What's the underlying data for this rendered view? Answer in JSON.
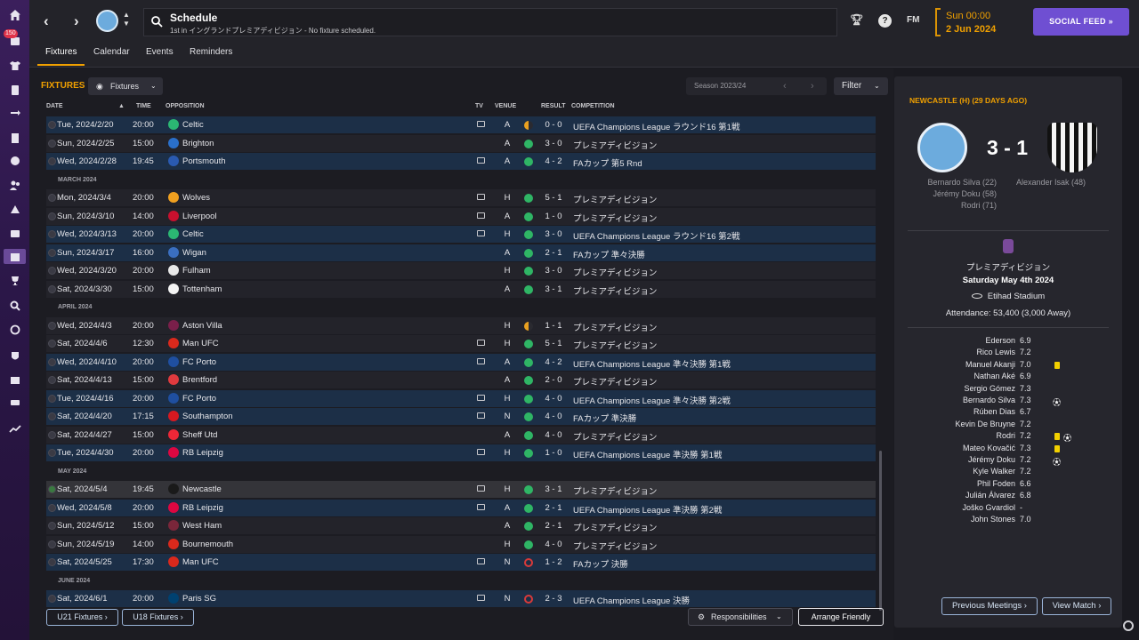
{
  "sidebar": {
    "badge": "150"
  },
  "header": {
    "title": "Schedule",
    "subtitle": "1st in イングランドプレミアディビジョン - No fixture scheduled.",
    "fm_label": "FM",
    "help": "?",
    "date_line1": "Sun 00:00",
    "date_line2": "2 Jun 2024",
    "social_feed": "SOCIAL FEED »"
  },
  "tabs": [
    "Fixtures",
    "Calendar",
    "Events",
    "Reminders"
  ],
  "fixtures": {
    "title": "FIXTURES",
    "view_dropdown": "Fixtures",
    "season": "Season 2023/24",
    "filter": "Filter",
    "columns": {
      "date": "DATE",
      "time": "TIME",
      "opposition": "OPPOSITION",
      "tv": "TV",
      "venue": "VENUE",
      "result": "RESULT",
      "competition": "COMPETITION"
    },
    "rows": [
      {
        "type": "m",
        "date": "Tue, 2024/2/20",
        "time": "20:00",
        "opp": "Celtic",
        "crest": "#2bb673",
        "tv": true,
        "venue": "A",
        "res": "draw",
        "score": "0 - 0",
        "comp": "UEFA Champions League ラウンド16 第1戦",
        "bg": "c1"
      },
      {
        "type": "m",
        "date": "Sun, 2024/2/25",
        "time": "15:00",
        "opp": "Brighton",
        "crest": "#2a6fc9",
        "tv": false,
        "venue": "A",
        "res": "win",
        "score": "3 - 0",
        "comp": "プレミアディビジョン",
        "bg": "c0"
      },
      {
        "type": "m",
        "date": "Wed, 2024/2/28",
        "time": "19:45",
        "opp": "Portsmouth",
        "crest": "#2a5ab0",
        "tv": true,
        "venue": "A",
        "res": "win",
        "score": "4 - 2",
        "comp": "FAカップ 第5 Rnd",
        "bg": "c1"
      },
      {
        "type": "s",
        "label": "MARCH 2024"
      },
      {
        "type": "m",
        "date": "Mon, 2024/3/4",
        "time": "20:00",
        "opp": "Wolves",
        "crest": "#f0a020",
        "tv": true,
        "venue": "H",
        "res": "win",
        "score": "5 - 1",
        "comp": "プレミアディビジョン",
        "bg": "c0"
      },
      {
        "type": "m",
        "date": "Sun, 2024/3/10",
        "time": "14:00",
        "opp": "Liverpool",
        "crest": "#c8102e",
        "tv": true,
        "venue": "A",
        "res": "win",
        "score": "1 - 0",
        "comp": "プレミアディビジョン",
        "bg": "c0"
      },
      {
        "type": "m",
        "date": "Wed, 2024/3/13",
        "time": "20:00",
        "opp": "Celtic",
        "crest": "#2bb673",
        "tv": true,
        "venue": "H",
        "res": "win",
        "score": "3 - 0",
        "comp": "UEFA Champions League ラウンド16 第2戦",
        "bg": "c1"
      },
      {
        "type": "m",
        "date": "Sun, 2024/3/17",
        "time": "16:00",
        "opp": "Wigan",
        "crest": "#3a6fc0",
        "tv": false,
        "venue": "A",
        "res": "win",
        "score": "2 - 1",
        "comp": "FAカップ 準々決勝",
        "bg": "c1"
      },
      {
        "type": "m",
        "date": "Wed, 2024/3/20",
        "time": "20:00",
        "opp": "Fulham",
        "crest": "#e8e8e8",
        "tv": false,
        "venue": "H",
        "res": "win",
        "score": "3 - 0",
        "comp": "プレミアディビジョン",
        "bg": "c0"
      },
      {
        "type": "m",
        "date": "Sat, 2024/3/30",
        "time": "15:00",
        "opp": "Tottenham",
        "crest": "#f4f4f4",
        "tv": false,
        "venue": "A",
        "res": "win",
        "score": "3 - 1",
        "comp": "プレミアディビジョン",
        "bg": "c0"
      },
      {
        "type": "s",
        "label": "APRIL 2024"
      },
      {
        "type": "m",
        "date": "Wed, 2024/4/3",
        "time": "20:00",
        "opp": "Aston Villa",
        "crest": "#7a1f4a",
        "tv": false,
        "venue": "H",
        "res": "draw",
        "score": "1 - 1",
        "comp": "プレミアディビジョン",
        "bg": "c0"
      },
      {
        "type": "m",
        "date": "Sat, 2024/4/6",
        "time": "12:30",
        "opp": "Man UFC",
        "crest": "#da291c",
        "tv": true,
        "venue": "H",
        "res": "win",
        "score": "5 - 1",
        "comp": "プレミアディビジョン",
        "bg": "c0"
      },
      {
        "type": "m",
        "date": "Wed, 2024/4/10",
        "time": "20:00",
        "opp": "FC Porto",
        "crest": "#1f4fa0",
        "tv": true,
        "venue": "A",
        "res": "win",
        "score": "4 - 2",
        "comp": "UEFA Champions League 準々決勝 第1戦",
        "bg": "c1"
      },
      {
        "type": "m",
        "date": "Sat, 2024/4/13",
        "time": "15:00",
        "opp": "Brentford",
        "crest": "#e03a3e",
        "tv": false,
        "venue": "A",
        "res": "win",
        "score": "2 - 0",
        "comp": "プレミアディビジョン",
        "bg": "c0"
      },
      {
        "type": "m",
        "date": "Tue, 2024/4/16",
        "time": "20:00",
        "opp": "FC Porto",
        "crest": "#1f4fa0",
        "tv": true,
        "venue": "H",
        "res": "win",
        "score": "4 - 0",
        "comp": "UEFA Champions League 準々決勝 第2戦",
        "bg": "c1"
      },
      {
        "type": "m",
        "date": "Sat, 2024/4/20",
        "time": "17:15",
        "opp": "Southampton",
        "crest": "#d71920",
        "tv": true,
        "venue": "N",
        "res": "win",
        "score": "4 - 0",
        "comp": "FAカップ 準決勝",
        "bg": "c1"
      },
      {
        "type": "m",
        "date": "Sat, 2024/4/27",
        "time": "15:00",
        "opp": "Sheff Utd",
        "crest": "#ee2737",
        "tv": false,
        "venue": "A",
        "res": "win",
        "score": "4 - 0",
        "comp": "プレミアディビジョン",
        "bg": "c0"
      },
      {
        "type": "m",
        "date": "Tue, 2024/4/30",
        "time": "20:00",
        "opp": "RB Leipzig",
        "crest": "#dd0741",
        "tv": true,
        "venue": "H",
        "res": "win",
        "score": "1 - 0",
        "comp": "UEFA Champions League 準決勝 第1戦",
        "bg": "c1"
      },
      {
        "type": "s",
        "label": "MAY 2024"
      },
      {
        "type": "m",
        "date": "Sat, 2024/5/4",
        "time": "19:45",
        "opp": "Newcastle",
        "crest": "#1a1a1a",
        "tv": true,
        "venue": "H",
        "res": "win",
        "score": "3 - 1",
        "comp": "プレミアディビジョン",
        "bg": "hl",
        "done": true
      },
      {
        "type": "m",
        "date": "Wed, 2024/5/8",
        "time": "20:00",
        "opp": "RB Leipzig",
        "crest": "#dd0741",
        "tv": true,
        "venue": "A",
        "res": "win",
        "score": "2 - 1",
        "comp": "UEFA Champions League 準決勝 第2戦",
        "bg": "c1"
      },
      {
        "type": "m",
        "date": "Sun, 2024/5/12",
        "time": "15:00",
        "opp": "West Ham",
        "crest": "#7a263a",
        "tv": false,
        "venue": "A",
        "res": "win",
        "score": "2 - 1",
        "comp": "プレミアディビジョン",
        "bg": "c0"
      },
      {
        "type": "m",
        "date": "Sun, 2024/5/19",
        "time": "14:00",
        "opp": "Bournemouth",
        "crest": "#da291c",
        "tv": false,
        "venue": "H",
        "res": "win",
        "score": "4 - 0",
        "comp": "プレミアディビジョン",
        "bg": "c0"
      },
      {
        "type": "m",
        "date": "Sat, 2024/5/25",
        "time": "17:30",
        "opp": "Man UFC",
        "crest": "#da291c",
        "tv": true,
        "venue": "N",
        "res": "loss",
        "score": "1 - 2",
        "comp": "FAカップ 決勝",
        "bg": "c1"
      },
      {
        "type": "s",
        "label": "JUNE 2024"
      },
      {
        "type": "m",
        "date": "Sat, 2024/6/1",
        "time": "20:00",
        "opp": "Paris SG",
        "crest": "#004170",
        "tv": true,
        "venue": "N",
        "res": "loss",
        "score": "2 - 3",
        "comp": "UEFA Champions League 決勝",
        "bg": "c1"
      }
    ],
    "btn_u21": "U21 Fixtures ›",
    "btn_u18": "U18 Fixtures ›",
    "btn_responsibilities": "Responsibilities",
    "btn_arrange": "Arrange Friendly"
  },
  "match": {
    "heading": "NEWCASTLE (H) (29 DAYS AGO)",
    "score": "3 - 1",
    "home_scorers": [
      "Bernardo Silva (22)",
      "Jérémy Doku (58)",
      "Rodri (71)"
    ],
    "away_scorers": [
      "Alexander Isak (48)"
    ],
    "competition": "プレミアディビジョン",
    "date": "Saturday May 4th 2024",
    "stadium": "Etihad Stadium",
    "attendance": "Attendance: 53,400 (3,000 Away)",
    "players": [
      {
        "name": "Ederson",
        "rating": "6.9",
        "yc": false,
        "goal": false
      },
      {
        "name": "Rico Lewis",
        "rating": "7.2",
        "yc": false,
        "goal": false
      },
      {
        "name": "Manuel Akanji",
        "rating": "7.0",
        "yc": true,
        "goal": false
      },
      {
        "name": "Nathan Aké",
        "rating": "6.9",
        "yc": false,
        "goal": false
      },
      {
        "name": "Sergio Gómez",
        "rating": "7.3",
        "yc": false,
        "goal": false
      },
      {
        "name": "Bernardo Silva",
        "rating": "7.3",
        "yc": false,
        "goal": true
      },
      {
        "name": "Rúben Dias",
        "rating": "6.7",
        "yc": false,
        "goal": false
      },
      {
        "name": "Kevin De Bruyne",
        "rating": "7.2",
        "yc": false,
        "goal": false
      },
      {
        "name": "Rodri",
        "rating": "7.2",
        "yc": true,
        "goal": true
      },
      {
        "name": "Mateo Kovačić",
        "rating": "7.3",
        "yc": true,
        "goal": false
      },
      {
        "name": "Jérémy Doku",
        "rating": "7.2",
        "yc": false,
        "goal": true
      },
      {
        "name": "Kyle Walker",
        "rating": "7.2",
        "yc": false,
        "goal": false
      },
      {
        "name": "Phil Foden",
        "rating": "6.6",
        "yc": false,
        "goal": false
      },
      {
        "name": "Julián Álvarez",
        "rating": "6.8",
        "yc": false,
        "goal": false
      },
      {
        "name": "Joško Gvardiol",
        "rating": "-",
        "yc": false,
        "goal": false
      },
      {
        "name": "John Stones",
        "rating": "7.0",
        "yc": false,
        "goal": false
      }
    ],
    "btn_previous": "Previous Meetings ›",
    "btn_view": "View Match ›"
  },
  "colors": {
    "accent": "#f0a000",
    "social": "#6f4fd2",
    "win": "#2fb565",
    "loss": "#d83a3a",
    "draw": "#e8a020"
  }
}
